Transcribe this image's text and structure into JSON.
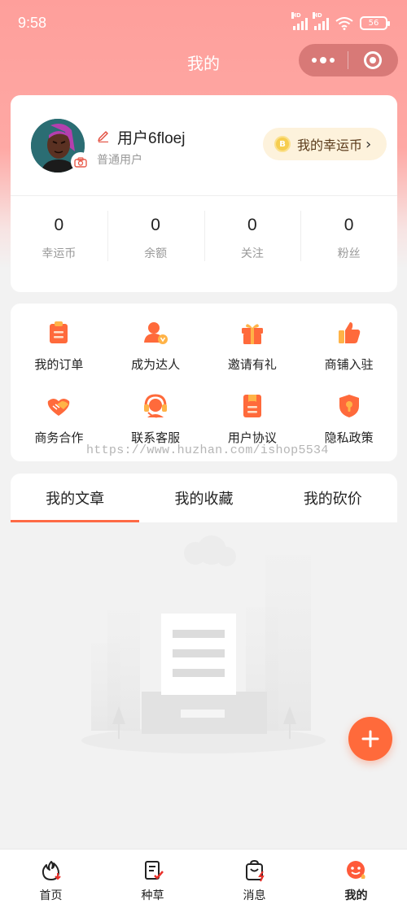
{
  "status_bar": {
    "time": "9:58",
    "network_1": "HD",
    "network_2": "HD",
    "battery": "56"
  },
  "nav": {
    "title": "我的"
  },
  "profile": {
    "username": "用户6floej",
    "level": "普通用户",
    "coin_button_label": "我的幸运币",
    "coin_icon_text": "B"
  },
  "stats": [
    {
      "value": "0",
      "label": "幸运币"
    },
    {
      "value": "0",
      "label": "余额"
    },
    {
      "value": "0",
      "label": "关注"
    },
    {
      "value": "0",
      "label": "粉丝"
    }
  ],
  "services": [
    {
      "label": "我的订单",
      "icon": "clipboard-icon"
    },
    {
      "label": "成为达人",
      "icon": "expert-user-icon"
    },
    {
      "label": "邀请有礼",
      "icon": "gift-icon"
    },
    {
      "label": "商铺入驻",
      "icon": "thumbs-up-icon"
    },
    {
      "label": "商务合作",
      "icon": "handshake-icon"
    },
    {
      "label": "联系客服",
      "icon": "headset-icon"
    },
    {
      "label": "用户协议",
      "icon": "document-icon"
    },
    {
      "label": "隐私政策",
      "icon": "shield-icon"
    }
  ],
  "watermark": "https://www.huzhan.com/ishop5534",
  "tabs": [
    {
      "label": "我的文章",
      "active": true
    },
    {
      "label": "我的收藏",
      "active": false
    },
    {
      "label": "我的砍价",
      "active": false
    }
  ],
  "bottom_tabs": [
    {
      "label": "首页",
      "icon": "home-fire-icon"
    },
    {
      "label": "种草",
      "icon": "notes-check-icon"
    },
    {
      "label": "消息",
      "icon": "message-bag-icon"
    },
    {
      "label": "我的",
      "icon": "profile-face-icon",
      "active": true
    }
  ],
  "colors": {
    "accent": "#fe6a45",
    "header": "#fea8a4",
    "coin_bg": "#fdf2dc"
  }
}
